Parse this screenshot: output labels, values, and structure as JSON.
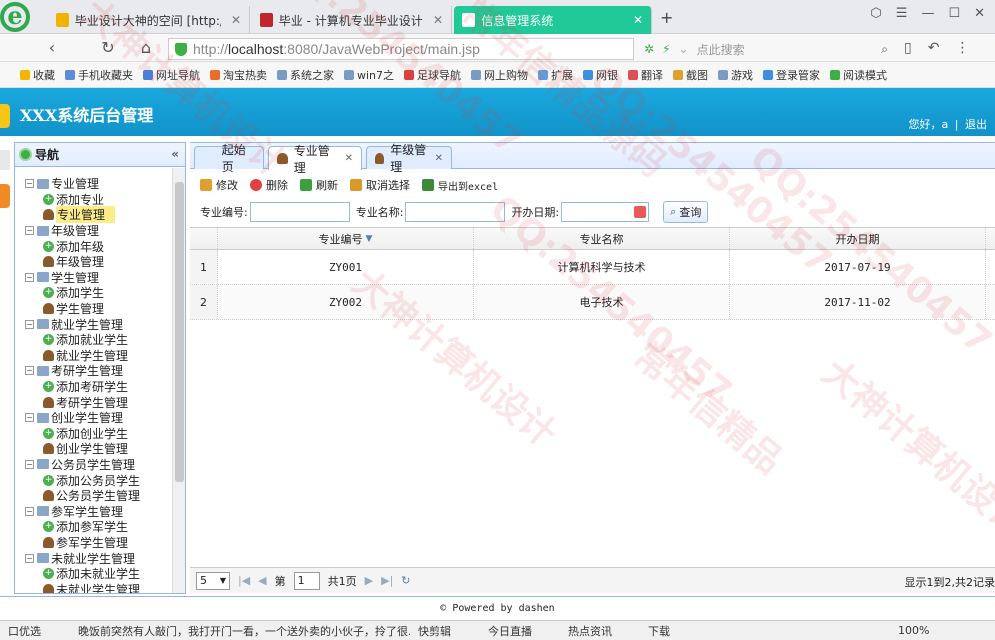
{
  "browser": {
    "tabs": [
      {
        "title": "毕业设计大神的空间 [http://28",
        "color": "#f0b400"
      },
      {
        "title": "毕业 - 计算机专业毕业设计源码",
        "color": "#c0262d"
      },
      {
        "title": "信息管理系统",
        "color": "#ffffff"
      }
    ],
    "new_tab": "+",
    "url_prefix": "http://",
    "url_host": "localhost",
    "url_rest": ":8080/JavaWebProject/main.jsp",
    "search_placeholder": "点此搜索",
    "bookmarks": [
      "收藏",
      "手机收藏夹",
      "网址导航",
      "淘宝热卖",
      "系统之家",
      "win7之",
      "足球导航",
      "网上购物",
      "扩展",
      "网银",
      "翻译",
      "截图",
      "游戏",
      "登录管家",
      "阅读模式"
    ]
  },
  "app": {
    "title": "XXX系统后台管理",
    "greeting": "您好，a",
    "separator": "|",
    "logout": "退出"
  },
  "nav": {
    "title": "导航",
    "collapse": "«",
    "groups": [
      {
        "label": "专业管理",
        "children": [
          {
            "label": "添加专业",
            "type": "add"
          },
          {
            "label": "专业管理",
            "type": "user",
            "selected": true
          }
        ]
      },
      {
        "label": "年级管理",
        "children": [
          {
            "label": "添加年级",
            "type": "add"
          },
          {
            "label": "年级管理",
            "type": "user"
          }
        ]
      },
      {
        "label": "学生管理",
        "children": [
          {
            "label": "添加学生",
            "type": "add"
          },
          {
            "label": "学生管理",
            "type": "user"
          }
        ]
      },
      {
        "label": "就业学生管理",
        "children": [
          {
            "label": "添加就业学生",
            "type": "add"
          },
          {
            "label": "就业学生管理",
            "type": "user"
          }
        ]
      },
      {
        "label": "考研学生管理",
        "children": [
          {
            "label": "添加考研学生",
            "type": "add"
          },
          {
            "label": "考研学生管理",
            "type": "user"
          }
        ]
      },
      {
        "label": "创业学生管理",
        "children": [
          {
            "label": "添加创业学生",
            "type": "add"
          },
          {
            "label": "创业学生管理",
            "type": "user"
          }
        ]
      },
      {
        "label": "公务员学生管理",
        "children": [
          {
            "label": "添加公务员学生",
            "type": "add"
          },
          {
            "label": "公务员学生管理",
            "type": "user"
          }
        ]
      },
      {
        "label": "参军学生管理",
        "children": [
          {
            "label": "添加参军学生",
            "type": "add"
          },
          {
            "label": "参军学生管理",
            "type": "user"
          }
        ]
      },
      {
        "label": "未就业学生管理",
        "children": [
          {
            "label": "添加未就业学生",
            "type": "add"
          },
          {
            "label": "未就业学生管理",
            "type": "user"
          }
        ]
      }
    ]
  },
  "tabs": [
    {
      "label": "起始页",
      "closable": false
    },
    {
      "label": "专业管理",
      "closable": true,
      "active": true
    },
    {
      "label": "年级管理",
      "closable": true
    }
  ],
  "toolbar": {
    "edit": "修改",
    "delete": "删除",
    "refresh": "刷新",
    "unselect": "取消选择",
    "export": "导出到excel"
  },
  "search": {
    "code_label": "专业编号:",
    "name_label": "专业名称:",
    "date_label": "开办日期:",
    "query": "查询"
  },
  "grid": {
    "columns": [
      "专业编号",
      "专业名称",
      "开办日期"
    ],
    "rows": [
      {
        "num": "1",
        "code": "ZY001",
        "name": "计算机科学与技术",
        "date": "2017-07-19"
      },
      {
        "num": "2",
        "code": "ZY002",
        "name": "电子技术",
        "date": "2017-11-02"
      }
    ]
  },
  "pager": {
    "page_size": "5",
    "page_prefix": "第",
    "page": "1",
    "page_suffix": "共1页",
    "info": "显示1到2,共2记录"
  },
  "footer": "© Powered by dashen",
  "statusbar": {
    "items": [
      "口优选",
      "晚饭前突然有人敲门，我打开门一看，一个送外卖的小伙子，拎了很...",
      "快剪辑",
      "今日直播",
      "热点资讯",
      "下载",
      "100%"
    ]
  },
  "watermarks": [
    "大神计算机设计",
    "QQ:254540457",
    "常年信精品源码",
    "QQ:254540457",
    "大神计算机设计",
    "QQ:254540457",
    "常年信精品",
    "QQ:254540457",
    "大神计算机设计"
  ]
}
